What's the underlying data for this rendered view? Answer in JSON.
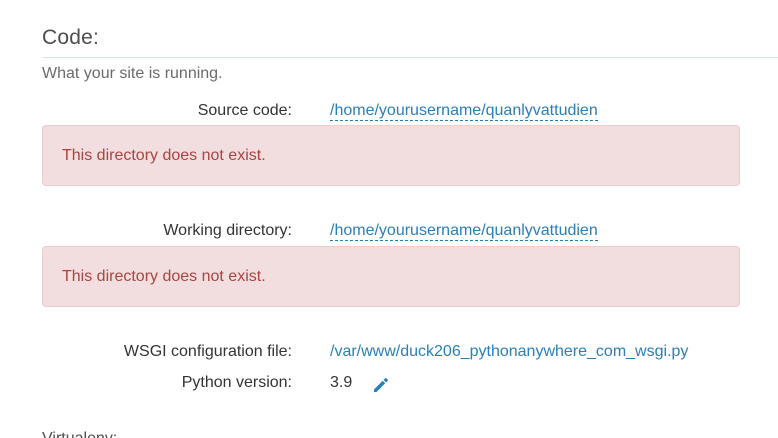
{
  "section": {
    "title": "Code:",
    "subtitle": "What your site is running."
  },
  "source_code": {
    "label": "Source code:",
    "value": "/home/yourusername/quanlyvattudien",
    "error": "This directory does not exist."
  },
  "working_directory": {
    "label": "Working directory:",
    "value": "/home/yourusername/quanlyvattudien",
    "error": "This directory does not exist."
  },
  "wsgi": {
    "label": "WSGI configuration file:",
    "value": "/var/www/duck206_pythonanywhere_com_wsgi.py"
  },
  "python_version": {
    "label": "Python version:",
    "value": "3.9",
    "edit_icon": "pencil-icon"
  },
  "next_section": {
    "title_partial": "Virtualenv:"
  },
  "colors": {
    "link": "#2a7fb8",
    "alert_bg": "#f2dede",
    "alert_text": "#a94442",
    "rule": "#d7e6ee"
  }
}
